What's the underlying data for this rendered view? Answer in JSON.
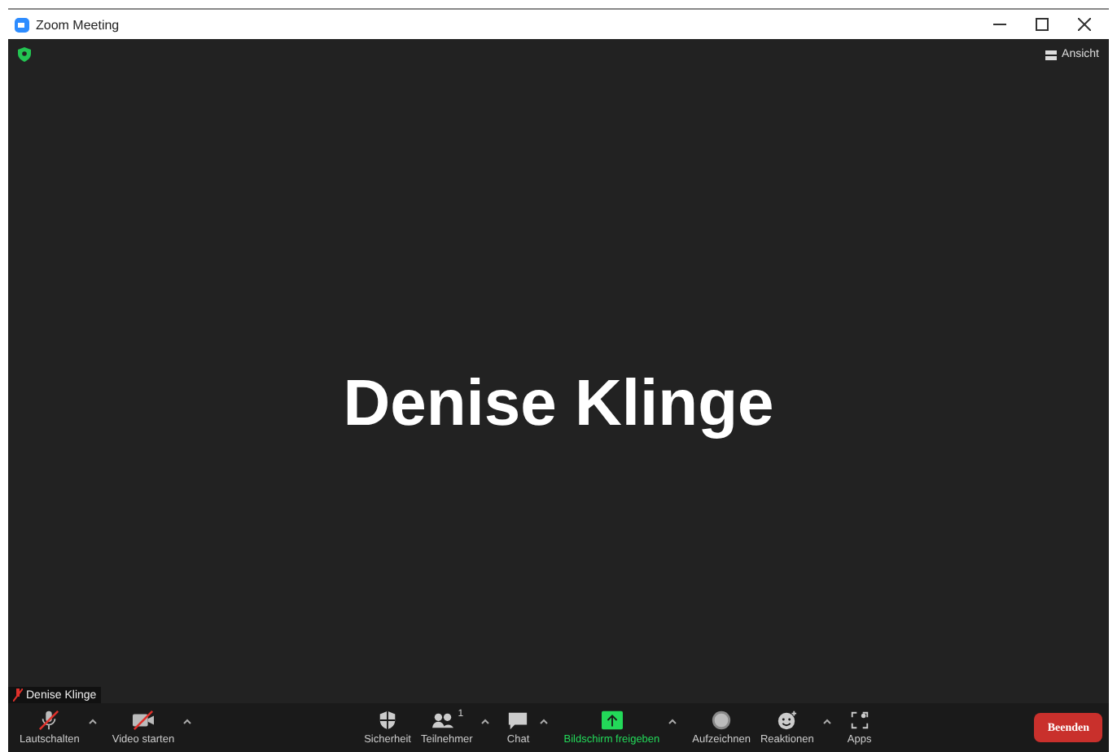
{
  "window": {
    "title": "Zoom Meeting"
  },
  "view_button": {
    "label": "Ansicht"
  },
  "speaker": {
    "name": "Denise Klinge"
  },
  "name_tag": {
    "label": "Denise Klinge",
    "muted": true
  },
  "toolbar": [
    {
      "kind": "audio",
      "label": "Lautschalten",
      "muted": true,
      "caret": true
    },
    {
      "kind": "video",
      "label": "Video starten",
      "muted": true,
      "caret": true
    },
    {
      "kind": "gap"
    },
    {
      "kind": "security",
      "label": "Sicherheit",
      "caret": false
    },
    {
      "kind": "participants",
      "label": "Teilnehmer",
      "count": "1",
      "caret": true
    },
    {
      "kind": "chat",
      "label": "Chat",
      "caret": true
    },
    {
      "kind": "share",
      "label": "Bildschirm freigeben",
      "caret": true,
      "highlighted": true
    },
    {
      "kind": "record",
      "label": "Aufzeichnen",
      "caret": false
    },
    {
      "kind": "reactions",
      "label": "Reaktionen",
      "caret": true
    },
    {
      "kind": "apps",
      "label": "Apps",
      "caret": false
    },
    {
      "kind": "gap"
    }
  ],
  "end_button": {
    "label": "Beenden"
  }
}
